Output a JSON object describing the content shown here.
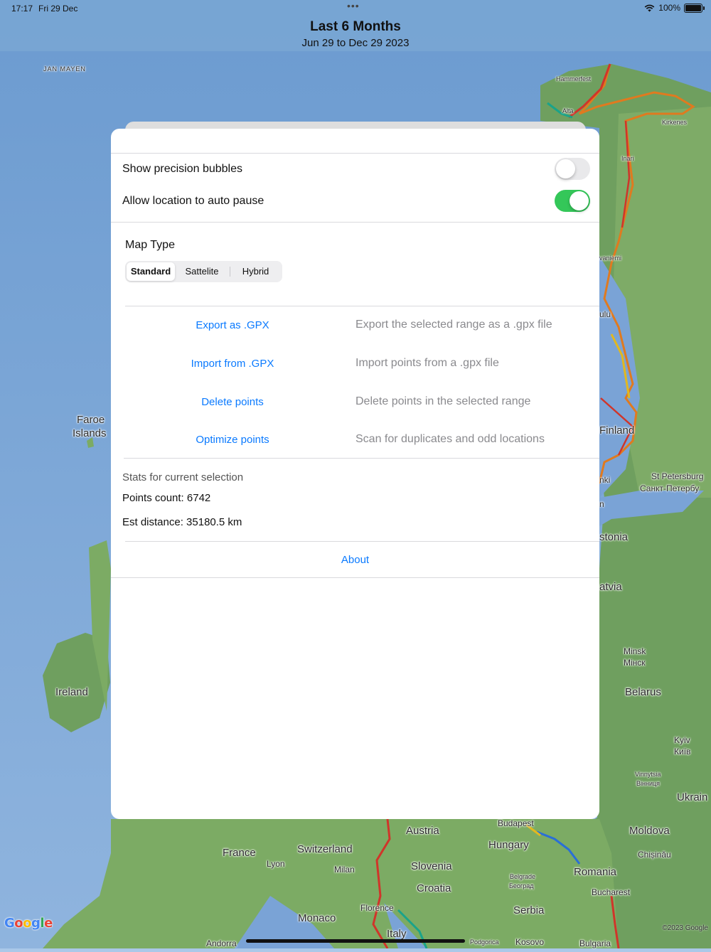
{
  "status": {
    "time": "17:17",
    "date": "Fri 29 Dec",
    "dots": "•••",
    "battery": "100%"
  },
  "header": {
    "title": "Last 6 Months",
    "subtitle": "Jun 29 to Dec 29 2023"
  },
  "settings": {
    "precision_label": "Show precision bubbles",
    "precision_on": false,
    "auto_pause_label": "Allow location to auto pause",
    "auto_pause_on": true
  },
  "map_type": {
    "title": "Map Type",
    "options": [
      "Standard",
      "Sattelite",
      "Hybrid"
    ],
    "selected": "Standard"
  },
  "actions": [
    {
      "label": "Export as .GPX",
      "description": "Export the selected range as a .gpx file"
    },
    {
      "label": "Import from .GPX",
      "description": "Import points from a .gpx file"
    },
    {
      "label": "Delete points",
      "description": "Delete points in the selected range"
    },
    {
      "label": "Optimize points",
      "description": "Scan for duplicates and odd locations"
    }
  ],
  "stats": {
    "title": "Stats for current selection",
    "points": "Points count: 6742",
    "distance": "Est distance: 35180.5 km"
  },
  "about_label": "About",
  "map": {
    "labels": {
      "jan_mayen": "JAN MAYEN",
      "hammerfest": "Hammerfest",
      "alta": "Alta",
      "kirkenes": "Kirkenes",
      "inari": "Inari",
      "rovaniemi": "vaniemi",
      "oulu": "ulu",
      "faroe1": "Faroe",
      "faroe2": "Islands",
      "finland": "Finland",
      "st_petersburg": "St Petersburg",
      "st_petersburg_ru": "Санкт-Петербу",
      "helsinki": "nki",
      "n": "n",
      "estonia": "stonia",
      "latvia": "atvia",
      "minsk": "Minsk",
      "minsk_ru": "Мінск",
      "belarus": "Belarus",
      "ireland": "Ireland",
      "kyiv": "Kyiv",
      "kyiv_ua": "Київ",
      "vinnytsia": "Vinnytsia",
      "vinnytsia_ua": "Вінниця",
      "ukraine": "Ukrain",
      "moldova": "Moldova",
      "chisinau": "Chișinău",
      "budapest": "Budapest",
      "austria": "Austria",
      "hungary": "Hungary",
      "france": "France",
      "switzerland": "Switzerland",
      "lyon": "Lyon",
      "milan": "Milan",
      "slovenia": "Slovenia",
      "croatia": "Croatia",
      "belgrade": "Belgrade",
      "belgrade_sr": "Београд",
      "romania": "Romania",
      "bucharest": "Bucharest",
      "florence": "Florence",
      "serbia": "Serbia",
      "monaco": "Monaco",
      "italy": "Italy",
      "podgorica": "Podgorica",
      "kosovo": "Kosovo",
      "bulgaria": "Bulgaria",
      "andorra": "Andorra"
    },
    "google": "Google",
    "copyright": "©2023 Google"
  },
  "colors": {
    "accent": "#0a7aff",
    "toggle_on": "#34c759",
    "route_red": "#d0352a",
    "route_orange": "#e07a1f",
    "route_teal": "#1aa38a",
    "route_blue": "#2a6fd6"
  }
}
